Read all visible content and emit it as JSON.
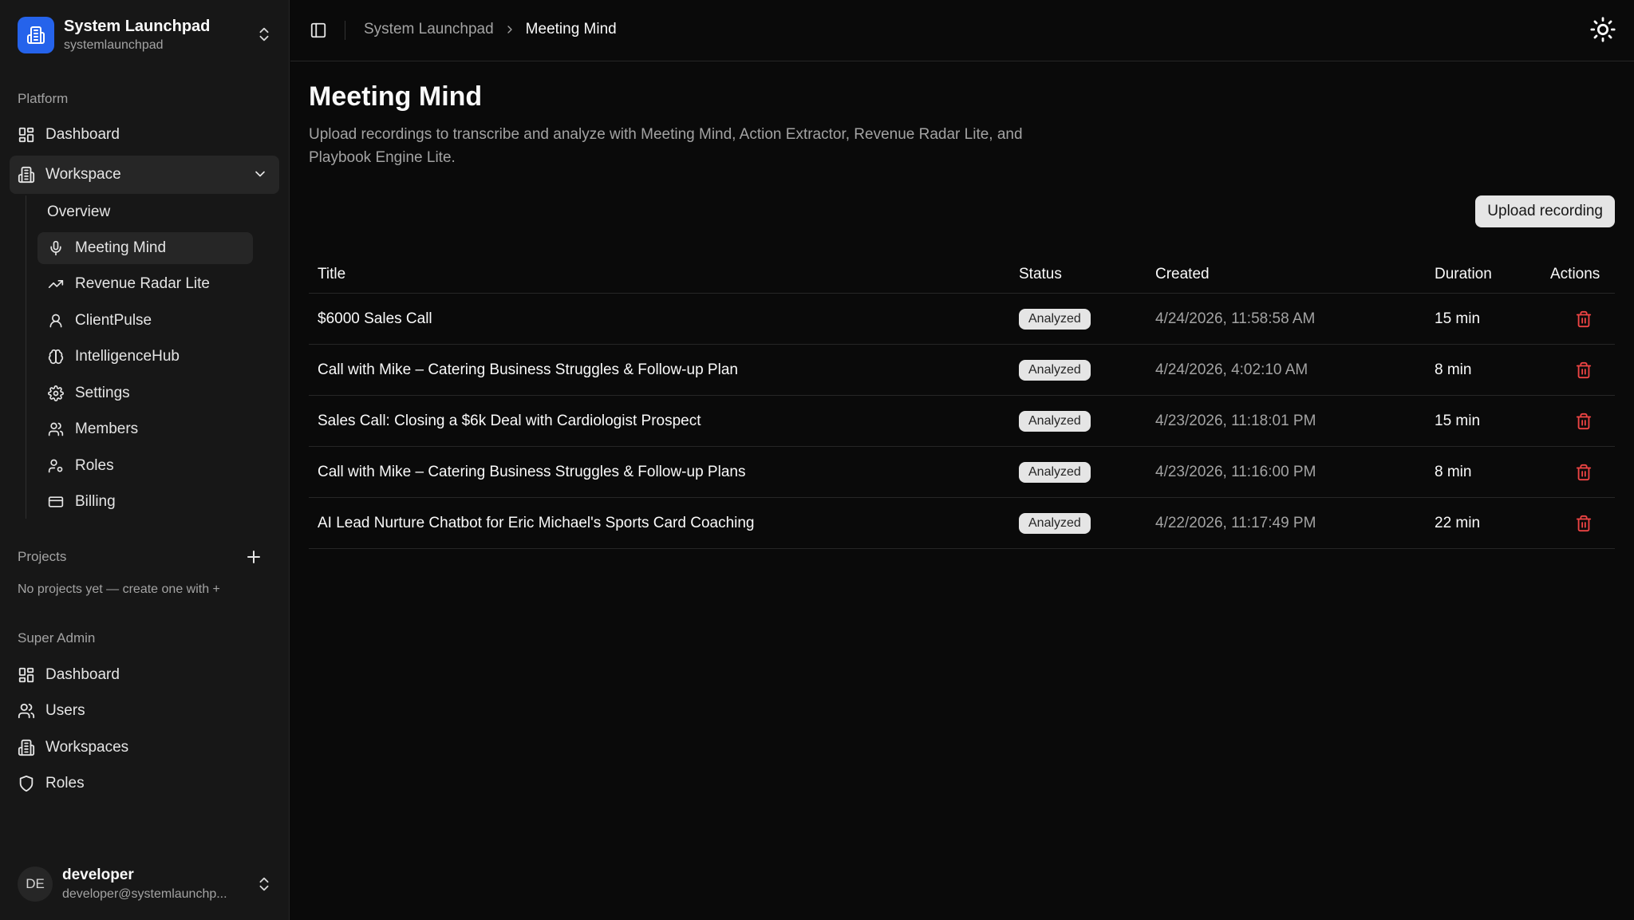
{
  "workspace": {
    "name": "System Launchpad",
    "slug": "systemlaunchpad"
  },
  "sidebar": {
    "platform_label": "Platform",
    "dashboard": "Dashboard",
    "workspace_group": "Workspace",
    "sub_items": [
      "Overview",
      "Meeting Mind",
      "Revenue Radar Lite",
      "ClientPulse",
      "IntelligenceHub",
      "Settings",
      "Members",
      "Roles",
      "Billing"
    ],
    "projects_label": "Projects",
    "projects_empty": "No projects yet — create one with +",
    "super_admin_label": "Super Admin",
    "admin_items": [
      "Dashboard",
      "Users",
      "Workspaces",
      "Roles"
    ]
  },
  "user": {
    "initials": "DE",
    "name": "developer",
    "email": "developer@systemlaunchp..."
  },
  "breadcrumb": {
    "parent": "System Launchpad",
    "current": "Meeting Mind"
  },
  "page": {
    "title": "Meeting Mind",
    "description": "Upload recordings to transcribe and analyze with Meeting Mind, Action Extractor, Revenue Radar Lite, and Playbook Engine Lite.",
    "upload_button": "Upload recording"
  },
  "table": {
    "headers": {
      "title": "Title",
      "status": "Status",
      "created": "Created",
      "duration": "Duration",
      "actions": "Actions"
    },
    "rows": [
      {
        "title": "$6000 Sales Call",
        "status": "Analyzed",
        "created": "4/24/2026, 11:58:58 AM",
        "duration": "15 min"
      },
      {
        "title": "Call with Mike – Catering Business Struggles & Follow-up Plan",
        "status": "Analyzed",
        "created": "4/24/2026, 4:02:10 AM",
        "duration": "8 min"
      },
      {
        "title": "Sales Call: Closing a $6k Deal with Cardiologist Prospect",
        "status": "Analyzed",
        "created": "4/23/2026, 11:18:01 PM",
        "duration": "15 min"
      },
      {
        "title": "Call with Mike – Catering Business Struggles & Follow-up Plans",
        "status": "Analyzed",
        "created": "4/23/2026, 11:16:00 PM",
        "duration": "8 min"
      },
      {
        "title": "AI Lead Nurture Chatbot for Eric Michael's Sports Card Coaching",
        "status": "Analyzed",
        "created": "4/22/2026, 11:17:49 PM",
        "duration": "22 min"
      }
    ]
  },
  "colors": {
    "accent": "#2563eb",
    "danger": "#ef4444",
    "background": "#0a0a0a",
    "sidebar": "#171717"
  }
}
